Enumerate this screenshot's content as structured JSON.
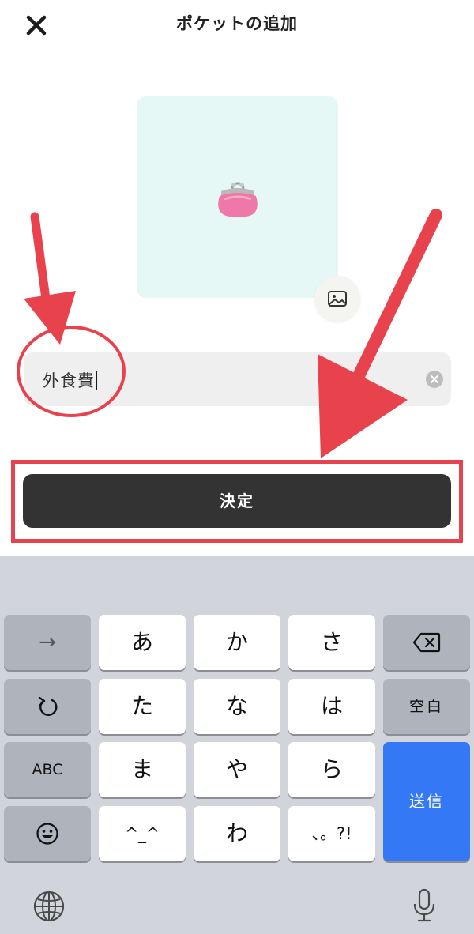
{
  "header": {
    "title": "ポケットの追加",
    "close_icon": "close-icon"
  },
  "pocket": {
    "icon": "coin-purse-icon",
    "icon_box_color": "#e6f8f5",
    "image_button_icon": "image-icon"
  },
  "name_field": {
    "value": "外食費",
    "clear_icon": "clear-icon"
  },
  "confirm_button": {
    "label": "決定",
    "color": "#333333"
  },
  "annotation": {
    "color": "#e8434d"
  },
  "keyboard": {
    "keys": {
      "arrow": "→",
      "a": "あ",
      "ka": "か",
      "sa": "さ",
      "ta": "た",
      "na": "な",
      "ha": "は",
      "ma": "ま",
      "ya": "や",
      "ra": "ら",
      "kaomoji": "^_^",
      "wa": "わ",
      "punct": "、。?!",
      "space": "空白",
      "abc": "ABC",
      "send": "送信"
    },
    "send_color": "#3478f6"
  }
}
